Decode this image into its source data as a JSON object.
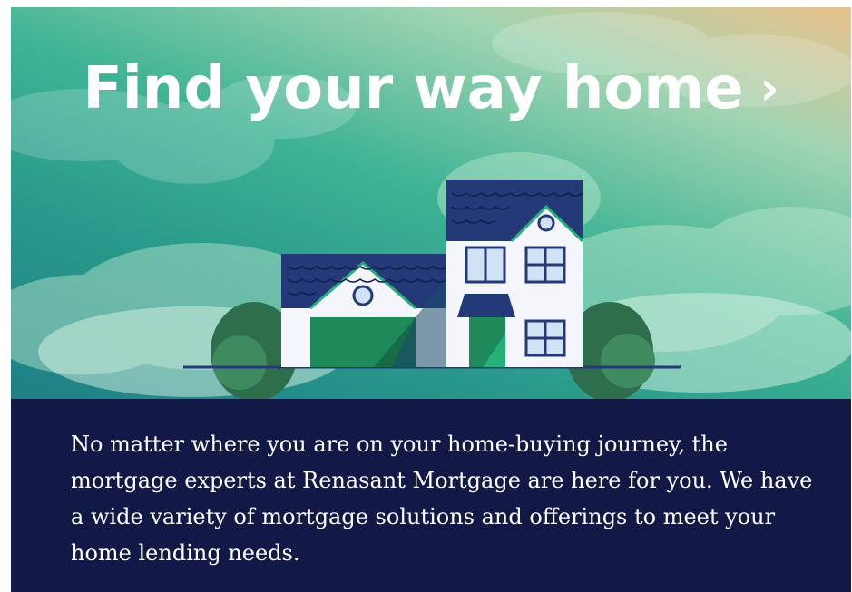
{
  "hero": {
    "title": "Find your way home",
    "chevron": "›"
  },
  "body": {
    "paragraph": "No matter where you are on your home-buying journey, the mortgage experts at Renasant Mortgage are here for you. We have a wide variety of mortgage solutions and offerings to meet your home lending needs."
  },
  "colors": {
    "panel_bg": "#121946",
    "sky_top": "#e9c28c",
    "sky_teal": "#3fb494",
    "roof_navy": "#243a78",
    "garage_green": "#1e8a5a",
    "wall_white": "#f4f6fb"
  },
  "icons": [
    "house-illustration",
    "cloud-illustration",
    "bush-illustration",
    "chevron-right-icon"
  ]
}
